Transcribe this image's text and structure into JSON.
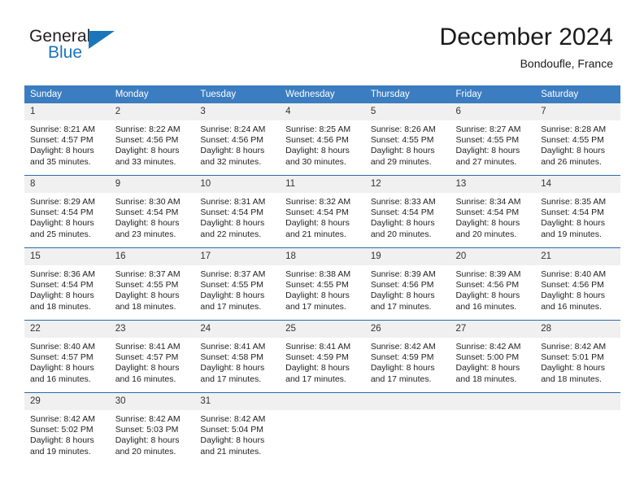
{
  "brand": {
    "name_part1": "General",
    "name_part2": "Blue",
    "logo_icon": "triangle-flag-icon",
    "accent_color": "#1b75bb"
  },
  "header": {
    "title": "December 2024",
    "location": "Bondoufle, France"
  },
  "calendar": {
    "header_bg": "#3b7dc0",
    "daynum_bg": "#f0f0f0",
    "row_divider_color": "#2c6aad",
    "weekday_headers": [
      "Sunday",
      "Monday",
      "Tuesday",
      "Wednesday",
      "Thursday",
      "Friday",
      "Saturday"
    ],
    "weeks": [
      [
        {
          "day": "1",
          "sunrise": "Sunrise: 8:21 AM",
          "sunset": "Sunset: 4:57 PM",
          "daylight_line1": "Daylight: 8 hours",
          "daylight_line2": "and 35 minutes."
        },
        {
          "day": "2",
          "sunrise": "Sunrise: 8:22 AM",
          "sunset": "Sunset: 4:56 PM",
          "daylight_line1": "Daylight: 8 hours",
          "daylight_line2": "and 33 minutes."
        },
        {
          "day": "3",
          "sunrise": "Sunrise: 8:24 AM",
          "sunset": "Sunset: 4:56 PM",
          "daylight_line1": "Daylight: 8 hours",
          "daylight_line2": "and 32 minutes."
        },
        {
          "day": "4",
          "sunrise": "Sunrise: 8:25 AM",
          "sunset": "Sunset: 4:56 PM",
          "daylight_line1": "Daylight: 8 hours",
          "daylight_line2": "and 30 minutes."
        },
        {
          "day": "5",
          "sunrise": "Sunrise: 8:26 AM",
          "sunset": "Sunset: 4:55 PM",
          "daylight_line1": "Daylight: 8 hours",
          "daylight_line2": "and 29 minutes."
        },
        {
          "day": "6",
          "sunrise": "Sunrise: 8:27 AM",
          "sunset": "Sunset: 4:55 PM",
          "daylight_line1": "Daylight: 8 hours",
          "daylight_line2": "and 27 minutes."
        },
        {
          "day": "7",
          "sunrise": "Sunrise: 8:28 AM",
          "sunset": "Sunset: 4:55 PM",
          "daylight_line1": "Daylight: 8 hours",
          "daylight_line2": "and 26 minutes."
        }
      ],
      [
        {
          "day": "8",
          "sunrise": "Sunrise: 8:29 AM",
          "sunset": "Sunset: 4:54 PM",
          "daylight_line1": "Daylight: 8 hours",
          "daylight_line2": "and 25 minutes."
        },
        {
          "day": "9",
          "sunrise": "Sunrise: 8:30 AM",
          "sunset": "Sunset: 4:54 PM",
          "daylight_line1": "Daylight: 8 hours",
          "daylight_line2": "and 23 minutes."
        },
        {
          "day": "10",
          "sunrise": "Sunrise: 8:31 AM",
          "sunset": "Sunset: 4:54 PM",
          "daylight_line1": "Daylight: 8 hours",
          "daylight_line2": "and 22 minutes."
        },
        {
          "day": "11",
          "sunrise": "Sunrise: 8:32 AM",
          "sunset": "Sunset: 4:54 PM",
          "daylight_line1": "Daylight: 8 hours",
          "daylight_line2": "and 21 minutes."
        },
        {
          "day": "12",
          "sunrise": "Sunrise: 8:33 AM",
          "sunset": "Sunset: 4:54 PM",
          "daylight_line1": "Daylight: 8 hours",
          "daylight_line2": "and 20 minutes."
        },
        {
          "day": "13",
          "sunrise": "Sunrise: 8:34 AM",
          "sunset": "Sunset: 4:54 PM",
          "daylight_line1": "Daylight: 8 hours",
          "daylight_line2": "and 20 minutes."
        },
        {
          "day": "14",
          "sunrise": "Sunrise: 8:35 AM",
          "sunset": "Sunset: 4:54 PM",
          "daylight_line1": "Daylight: 8 hours",
          "daylight_line2": "and 19 minutes."
        }
      ],
      [
        {
          "day": "15",
          "sunrise": "Sunrise: 8:36 AM",
          "sunset": "Sunset: 4:54 PM",
          "daylight_line1": "Daylight: 8 hours",
          "daylight_line2": "and 18 minutes."
        },
        {
          "day": "16",
          "sunrise": "Sunrise: 8:37 AM",
          "sunset": "Sunset: 4:55 PM",
          "daylight_line1": "Daylight: 8 hours",
          "daylight_line2": "and 18 minutes."
        },
        {
          "day": "17",
          "sunrise": "Sunrise: 8:37 AM",
          "sunset": "Sunset: 4:55 PM",
          "daylight_line1": "Daylight: 8 hours",
          "daylight_line2": "and 17 minutes."
        },
        {
          "day": "18",
          "sunrise": "Sunrise: 8:38 AM",
          "sunset": "Sunset: 4:55 PM",
          "daylight_line1": "Daylight: 8 hours",
          "daylight_line2": "and 17 minutes."
        },
        {
          "day": "19",
          "sunrise": "Sunrise: 8:39 AM",
          "sunset": "Sunset: 4:56 PM",
          "daylight_line1": "Daylight: 8 hours",
          "daylight_line2": "and 17 minutes."
        },
        {
          "day": "20",
          "sunrise": "Sunrise: 8:39 AM",
          "sunset": "Sunset: 4:56 PM",
          "daylight_line1": "Daylight: 8 hours",
          "daylight_line2": "and 16 minutes."
        },
        {
          "day": "21",
          "sunrise": "Sunrise: 8:40 AM",
          "sunset": "Sunset: 4:56 PM",
          "daylight_line1": "Daylight: 8 hours",
          "daylight_line2": "and 16 minutes."
        }
      ],
      [
        {
          "day": "22",
          "sunrise": "Sunrise: 8:40 AM",
          "sunset": "Sunset: 4:57 PM",
          "daylight_line1": "Daylight: 8 hours",
          "daylight_line2": "and 16 minutes."
        },
        {
          "day": "23",
          "sunrise": "Sunrise: 8:41 AM",
          "sunset": "Sunset: 4:57 PM",
          "daylight_line1": "Daylight: 8 hours",
          "daylight_line2": "and 16 minutes."
        },
        {
          "day": "24",
          "sunrise": "Sunrise: 8:41 AM",
          "sunset": "Sunset: 4:58 PM",
          "daylight_line1": "Daylight: 8 hours",
          "daylight_line2": "and 17 minutes."
        },
        {
          "day": "25",
          "sunrise": "Sunrise: 8:41 AM",
          "sunset": "Sunset: 4:59 PM",
          "daylight_line1": "Daylight: 8 hours",
          "daylight_line2": "and 17 minutes."
        },
        {
          "day": "26",
          "sunrise": "Sunrise: 8:42 AM",
          "sunset": "Sunset: 4:59 PM",
          "daylight_line1": "Daylight: 8 hours",
          "daylight_line2": "and 17 minutes."
        },
        {
          "day": "27",
          "sunrise": "Sunrise: 8:42 AM",
          "sunset": "Sunset: 5:00 PM",
          "daylight_line1": "Daylight: 8 hours",
          "daylight_line2": "and 18 minutes."
        },
        {
          "day": "28",
          "sunrise": "Sunrise: 8:42 AM",
          "sunset": "Sunset: 5:01 PM",
          "daylight_line1": "Daylight: 8 hours",
          "daylight_line2": "and 18 minutes."
        }
      ],
      [
        {
          "day": "29",
          "sunrise": "Sunrise: 8:42 AM",
          "sunset": "Sunset: 5:02 PM",
          "daylight_line1": "Daylight: 8 hours",
          "daylight_line2": "and 19 minutes."
        },
        {
          "day": "30",
          "sunrise": "Sunrise: 8:42 AM",
          "sunset": "Sunset: 5:03 PM",
          "daylight_line1": "Daylight: 8 hours",
          "daylight_line2": "and 20 minutes."
        },
        {
          "day": "31",
          "sunrise": "Sunrise: 8:42 AM",
          "sunset": "Sunset: 5:04 PM",
          "daylight_line1": "Daylight: 8 hours",
          "daylight_line2": "and 21 minutes."
        },
        {
          "day": "",
          "sunrise": "",
          "sunset": "",
          "daylight_line1": "",
          "daylight_line2": "",
          "empty": true
        },
        {
          "day": "",
          "sunrise": "",
          "sunset": "",
          "daylight_line1": "",
          "daylight_line2": "",
          "empty": true
        },
        {
          "day": "",
          "sunrise": "",
          "sunset": "",
          "daylight_line1": "",
          "daylight_line2": "",
          "empty": true
        },
        {
          "day": "",
          "sunrise": "",
          "sunset": "",
          "daylight_line1": "",
          "daylight_line2": "",
          "empty": true
        }
      ]
    ]
  }
}
